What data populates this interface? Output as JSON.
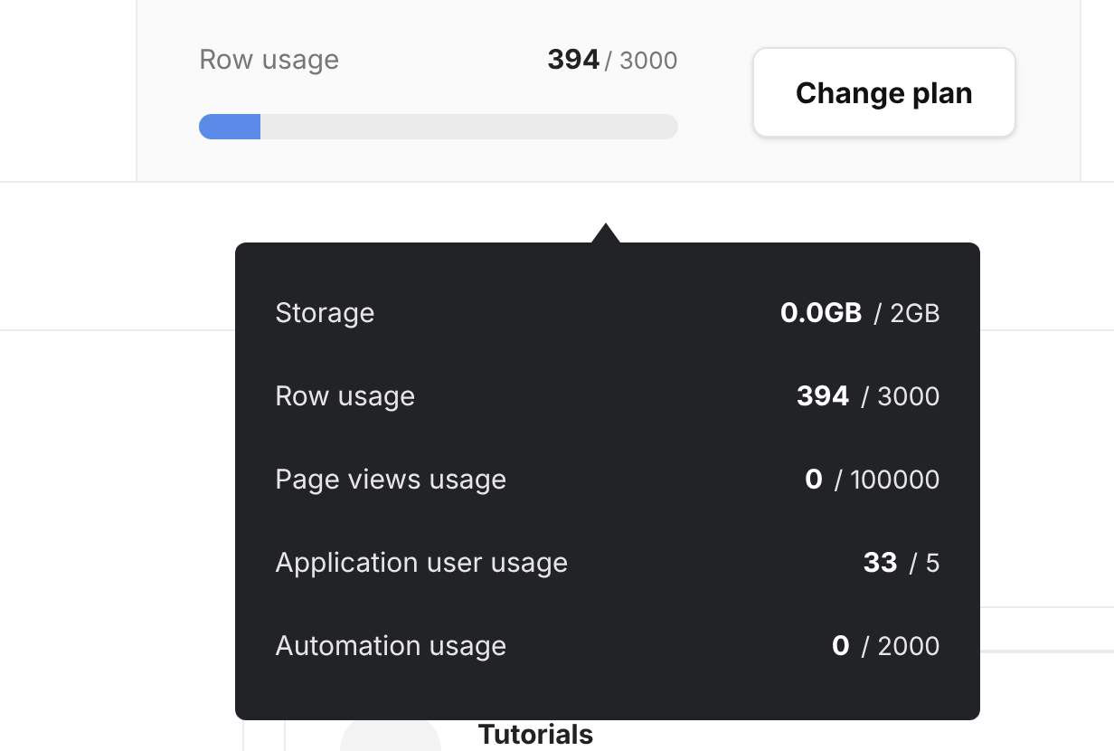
{
  "usage_panel": {
    "label": "Row usage",
    "value": "394",
    "limit": "/ 3000",
    "level": 0.13,
    "button": "Change plan"
  },
  "tooltip": {
    "rows": [
      {
        "label": "Storage",
        "value": "0.0GB",
        "limit": "/ 2GB"
      },
      {
        "label": "Row usage",
        "value": "394",
        "limit": "/ 3000"
      },
      {
        "label": "Page views usage",
        "value": "0",
        "limit": "/ 100000"
      },
      {
        "label": "Application user usage",
        "value": "33",
        "limit": "/ 5"
      },
      {
        "label": "Automation usage",
        "value": "0",
        "limit": "/ 2000"
      }
    ]
  },
  "tutorials": {
    "title": "Tutorials"
  }
}
